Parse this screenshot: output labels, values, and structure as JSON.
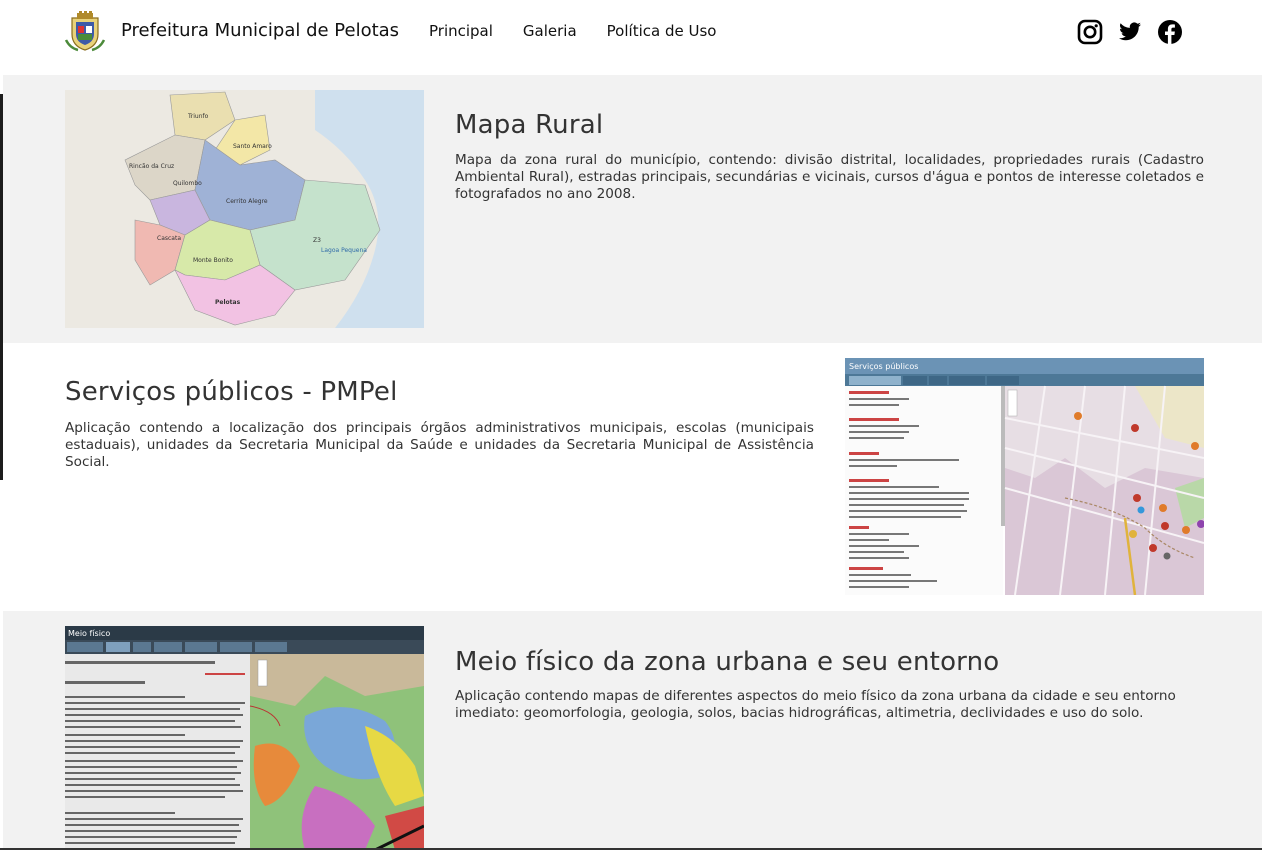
{
  "header": {
    "site_title": "Prefeitura Municipal de Pelotas",
    "nav": [
      "Principal",
      "Galeria",
      "Política de Uso"
    ],
    "social_icons": [
      "instagram-icon",
      "twitter-icon",
      "facebook-icon"
    ]
  },
  "cards": [
    {
      "title": "Mapa Rural",
      "description": "Mapa da zona rural do município, contendo: divisão distrital, localidades, propriedades rurais (Cadastro Ambiental Rural), estradas principais, secundárias e vicinais, cursos d'água e pontos de interesse coletados e fotografados no ano 2008.",
      "map_labels": [
        "Triunfo",
        "Santo Amaro",
        "Rincão da Cruz",
        "Quilombo",
        "Cerrito Alegre",
        "Z3",
        "Lagoa Pequena",
        "Cascata",
        "Monte Bonito",
        "Pelotas"
      ]
    },
    {
      "title": "Serviços públicos - PMPel",
      "description": "Aplicação contendo a localização dos principais órgãos administrativos municipais, escolas (municipais estaduais), unidades da Secretaria Municipal da Saúde e unidades da Secretaria Municipal de Assistência Social.",
      "app_title": "Serviços públicos"
    },
    {
      "title": "Meio físico da zona urbana e seu entorno",
      "description": "Aplicação contendo mapas de diferentes aspectos do meio físico da zona urbana da cidade e seu entorno imediato: geomorfologia, geologia, solos, bacias hidrográficas, altimetria, declividades e uso do solo.",
      "app_title": "Meio físico"
    }
  ],
  "colors": {
    "section_grey": "#f2f2f2",
    "text": "#333333",
    "app_header": "#6b93b5"
  }
}
